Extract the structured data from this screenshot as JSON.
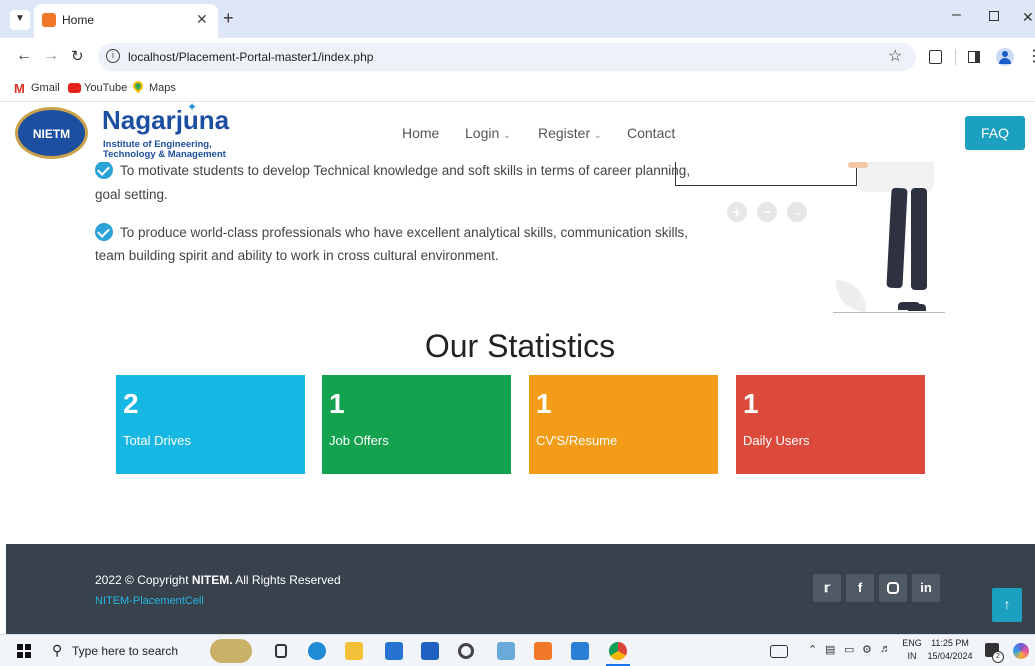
{
  "browser": {
    "tab_title": "Home",
    "new_tab": "+",
    "address": "localhost/Placement-Portal-master1/index.php",
    "bookmarks": [
      "Gmail",
      "YouTube",
      "Maps"
    ]
  },
  "site": {
    "brand_name": "Nagarjuna",
    "brand_sub1": "Institute of Engineering,",
    "brand_sub2": "Technology & Management",
    "logo_text": "NIETM",
    "nav": {
      "home": "Home",
      "login": "Login",
      "register": "Register",
      "contact": "Contact",
      "faq": "FAQ"
    },
    "points": [
      "To motivate students to develop Technical knowledge and soft skills in terms of career planning,",
      "goal setting.",
      "To produce world-class professionals who have excellent analytical skills, communication skills,",
      "team building spirit and ability to work in cross cultural environment."
    ],
    "stats_title": "Our Statistics",
    "stats": [
      {
        "value": "2",
        "label": "Total Drives",
        "color": "#17b7e4"
      },
      {
        "value": "1",
        "label": "Job Offers",
        "color": "#13a24e"
      },
      {
        "value": "1",
        "label": "CV'S/Resume",
        "color": "#f39c17"
      },
      {
        "value": "1",
        "label": "Daily Users",
        "color": "#dc4a3b"
      }
    ],
    "footer": {
      "copyright_pre": "2022 © Copyright ",
      "copyright_bold": "NITEM.",
      "copyright_post": " All Rights Reserved",
      "link": "NITEM-PlacementCell"
    }
  },
  "taskbar": {
    "search_placeholder": "Type here to search",
    "lang1": "ENG",
    "lang2": "IN",
    "time": "11:25 PM",
    "date": "15/04/2024",
    "notif_count": "2"
  },
  "colors": {
    "accent": "#1ba0c0",
    "brand_blue": "#1d4fa0",
    "footer_bg": "#37424d"
  }
}
